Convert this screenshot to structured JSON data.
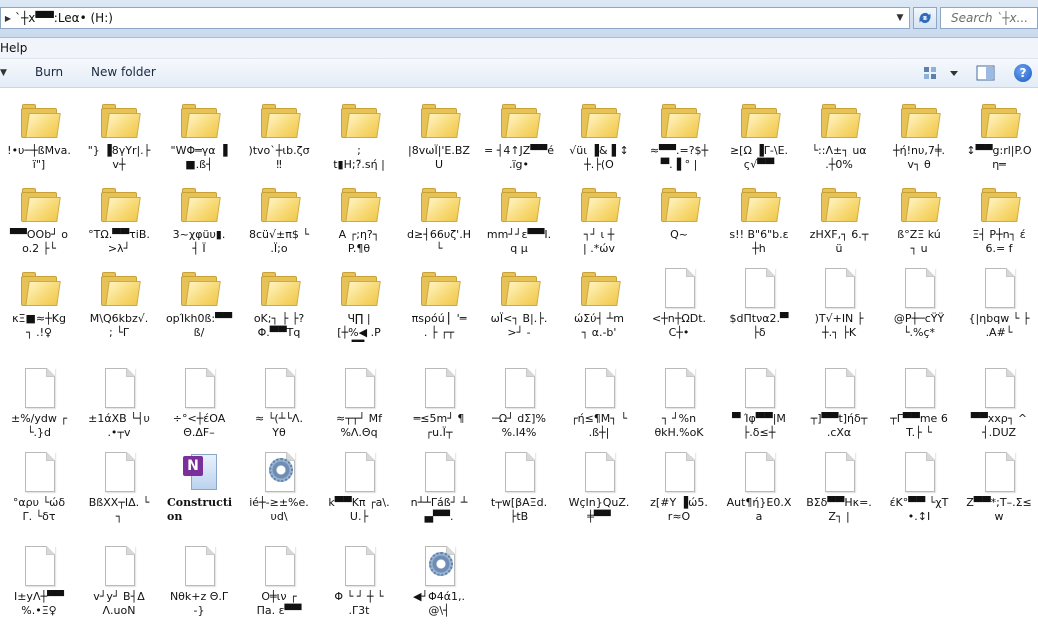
{
  "address": {
    "path": "`┼x▀▀:Leα• (H:)"
  },
  "search": {
    "placeholder": "Search `┼x..."
  },
  "menu": {
    "items": [
      "Help"
    ]
  },
  "toolbar": {
    "burn_label": "Burn",
    "new_folder_label": "New folder"
  },
  "items": [
    {
      "type": "folder",
      "label": "!•υ─┼ßMva.\nï\"]"
    },
    {
      "type": "folder",
      "label": "\"} ▐8γYr|.├\nv┼"
    },
    {
      "type": "folder",
      "label": "\"WΦ═γα ▐\n■.ß┤"
    },
    {
      "type": "folder",
      "label": ")tvo`┼ιb.ζσ\n‼"
    },
    {
      "type": "folder",
      "label": ";\nt▮H;?̃.sή |"
    },
    {
      "type": "folder",
      "label": "|8vωÏ|'E.BZ\nU"
    },
    {
      "type": "folder",
      "label": "= ┤4↑JZ▀▀é\n.ïg•"
    },
    {
      "type": "folder",
      "label": "√üι ▐&▐ ↕\n┼.├(O"
    },
    {
      "type": "folder",
      "label": "≈▀▀.=?$┼\n▀.▐ ° |"
    },
    {
      "type": "folder",
      "label": "≥[Ω ▐Γ-\\E.\nς√▀▀"
    },
    {
      "type": "folder",
      "label": "└::Λ±┐ uα\n.┼0%"
    },
    {
      "type": "folder",
      "label": "┼ή!nυ,7╪.\nv┐ θ"
    },
    {
      "type": "folder",
      "label": "↕▀▀g:rl|P.O\nη═"
    },
    {
      "type": "folder",
      "label": "▀▀OOb┘ o\no.2 ├└"
    },
    {
      "type": "folder",
      "label": "°TΩ.▀▀τiB.\n>λ┘"
    },
    {
      "type": "folder",
      "label": "3~χφüυ▮.\n┤ Ï"
    },
    {
      "type": "folder",
      "label": "8cü√±π$ └\n.Ï;o"
    },
    {
      "type": "folder",
      "label": "A ┌;η?┐\nP.¶θ"
    },
    {
      "type": "folder",
      "label": "d≥┤66υζ'.H\n└"
    },
    {
      "type": "folder",
      "label": "mm┘┘ε▀▀I.\nq μ"
    },
    {
      "type": "folder",
      "label": "┐┘ ι ┼\n| .*ώv"
    },
    {
      "type": "folder",
      "label": "Q~"
    },
    {
      "type": "folder",
      "label": "s!! B\"6\"b.ε\n┼h"
    },
    {
      "type": "folder",
      "label": "zHXF,┐ 6.┬\nü"
    },
    {
      "type": "folder",
      "label": "ß°ZΞ kú\n┐ u"
    },
    {
      "type": "folder",
      "label": "Ξ┤ P┼n┐ έ\n6.= f"
    },
    {
      "type": "folder",
      "label": "κΞ■≈┼Kg\n┐ .!♀"
    },
    {
      "type": "folder",
      "label": "M\\Q6kbz√.\n; └Γ"
    },
    {
      "type": "folder",
      "label": "opΊkh0ß:▀▀\nß/"
    },
    {
      "type": "folder",
      "label": "οK;┐ ├ ├?\nΦ.▀▀Tq"
    },
    {
      "type": "folder",
      "label": "Ч∏ |\n[┼%◀ .P\n▐▀F"
    },
    {
      "type": "folder",
      "label": "πsρόú ▏'═\n. ├ ┌┬"
    },
    {
      "type": "folder",
      "label": "ωΪ<┐ B|.├.\n>┘ -"
    },
    {
      "type": "folder",
      "label": "ώΣύ┤ ┴m\n┐ α.-b'"
    },
    {
      "type": "file",
      "label": "<┼n┼ΩDt.\nC┼•"
    },
    {
      "type": "file",
      "label": "$dΠtνα2.▀\n├δ"
    },
    {
      "type": "file",
      "label": ")T√+ΙΝ ├\n┼.┐ ├K"
    },
    {
      "type": "file",
      "label": "@P┼─cΫΫ\n└.%ç*"
    },
    {
      "type": "file",
      "label": "{|ηbqw └ ├\n.A#└"
    },
    {
      "type": "file",
      "label": "±%/ydw ┌\n└.}d"
    },
    {
      "type": "file",
      "label": "±1άXB └┤υ\n.•┬v"
    },
    {
      "type": "file",
      "label": "÷°<┼έOA\nΘ.ΔF–"
    },
    {
      "type": "file",
      "label": "≈ └(┴└Λ.\nΥθ"
    },
    {
      "type": "file",
      "label": "≈┬┬┘ Mf\n%Λ.Θq"
    },
    {
      "type": "file",
      "label": "═≤5m┘ ¶\n┌u.Ϊ┬"
    },
    {
      "type": "file",
      "label": "─Ω┘ dΣ]%\n%.I4%"
    },
    {
      "type": "file",
      "label": "┌ή≤¶M┐ └\n.ß┼|"
    },
    {
      "type": "file",
      "label": "┐ ┘%n\nθkH.%oK"
    },
    {
      "type": "file",
      "label": "▀ Ίφ▀▀|M\n├.δ≤┼"
    },
    {
      "type": "file",
      "label": "┬]▀▀t]ήδ┬\n.cXα"
    },
    {
      "type": "file",
      "label": "┬Γ▀▀me 6\nT.├ └"
    },
    {
      "type": "file",
      "label": "▀▀xxρ┐ ^\n┤.DUZ"
    },
    {
      "type": "file",
      "label": "°αρυ └ώδ\nΓ. └δτ"
    },
    {
      "type": "file",
      "label": "BßXX┬ΙΔ. └\n┐"
    },
    {
      "type": "onenote",
      "label": "Constructi\non"
    },
    {
      "type": "gear",
      "label": "ié┼-≥±%e.\nυd\\"
    },
    {
      "type": "file",
      "label": "k▀▀Kπ ┌a\\.\nU.├"
    },
    {
      "type": "file",
      "label": "n┴┴Γáß┘ ┴\n▄▀▀."
    },
    {
      "type": "file",
      "label": "t┬w[βAΞd.\n├tB"
    },
    {
      "type": "file",
      "label": "WçIn}QuZ.\n╪▀▀"
    },
    {
      "type": "file",
      "label": "z[#Y ▐ώ5.\nr≈O"
    },
    {
      "type": "file",
      "label": "Aut¶ή}E0.X\na"
    },
    {
      "type": "file",
      "label": "BΣδ▀▀Hκ=.\nZ┐ |"
    },
    {
      "type": "file",
      "label": "έK°▀▀ └χT\n•.↕I"
    },
    {
      "type": "file",
      "label": "Z▀▀*;Τ–.Σ≤\nw"
    },
    {
      "type": "file",
      "label": "I±yΛ┼▀▀\n%.•Ξ♀"
    },
    {
      "type": "file",
      "label": "v┘y┘ B┤Δ\nΛ.uoN"
    },
    {
      "type": "file",
      "label": "Nθk+z Θ.Γ\n-}"
    },
    {
      "type": "file",
      "label": "O╪ιν ┌\nΠa. ε▀▀"
    },
    {
      "type": "file",
      "label": "Φ └ ┘ ┼ └\n.Γ3t"
    },
    {
      "type": "gear",
      "label": "◀┘Φ4ά1,.\n@\\┤"
    }
  ]
}
